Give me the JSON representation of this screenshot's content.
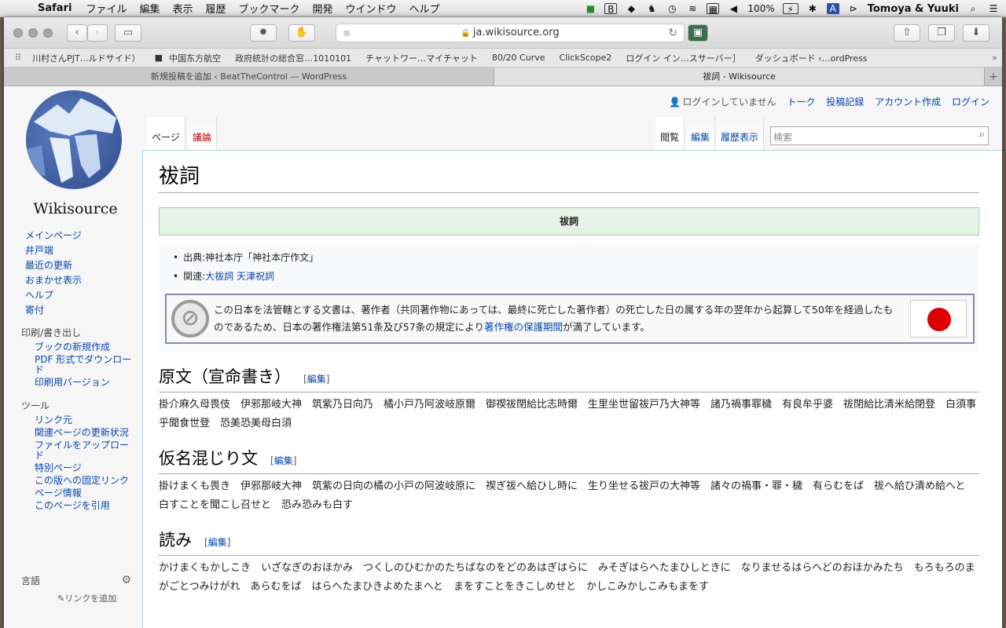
{
  "menubar": {
    "app": "Safari",
    "items": [
      "ファイル",
      "編集",
      "表示",
      "履歴",
      "ブックマーク",
      "開発",
      "ウインドウ",
      "ヘルプ"
    ],
    "battery": "100%",
    "user": "Tomoya & Yuuki"
  },
  "browser": {
    "url": "ja.wikisource.org",
    "favorites": [
      "川村さんPJT…ルドサイド）",
      "中国东方航空",
      "政府統計の総合窓…1010101",
      "チャットワー…マイチャット",
      "80/20 Curve",
      "ClickScope2",
      "ログイン イン…スサーバー］",
      "ダッシュボード ‹…ordPress"
    ],
    "tabs": [
      "新規投稿を追加 ‹ BeatTheControl — WordPress",
      "祓詞 - Wikisource"
    ]
  },
  "logo": {
    "name": "Wikisource"
  },
  "nav": {
    "main": [
      "メインページ",
      "井戸端",
      "最近の更新",
      "おまかせ表示",
      "ヘルプ",
      "寄付"
    ],
    "print_heading": "印刷/書き出し",
    "print": [
      "ブックの新規作成",
      "PDF 形式でダウンロード",
      "印刷用バージョン"
    ],
    "tools_heading": "ツール",
    "tools": [
      "リンク元",
      "関連ページの更新状況",
      "ファイルをアップロード",
      "特別ページ",
      "この版への固定リンク",
      "ページ情報",
      "このページを引用"
    ],
    "lang_heading": "言語",
    "add_links": "リンクを追加"
  },
  "personal": {
    "not_logged_in": "ログインしていません",
    "talk": "トーク",
    "contribs": "投稿記録",
    "create_account": "アカウント作成",
    "login": "ログイン"
  },
  "tabs": {
    "page": "ページ",
    "discussion": "議論",
    "read": "閲覧",
    "edit": "編集",
    "history": "履歴表示"
  },
  "search": {
    "placeholder": "検索"
  },
  "article": {
    "title": "祓詞",
    "header_title": "祓詞",
    "source_label": "出典:神社本庁「神社本庁作文」",
    "related_label": "関連:",
    "related_links": [
      "大祓詞",
      "天津祝詞"
    ],
    "license_text": "この日本を法管轄とする文書は、著作者（共同著作物にあっては、最終に死亡した著作者）の死亡した日の属する年の翌年から起算して50年を経過したものであるため、日本の著作権法第51条及び57条の規定により",
    "license_link": "著作権の保護期間",
    "license_end": "が満了しています。",
    "edit_label": "編集",
    "sections": [
      {
        "heading": "原文（宣命書き）",
        "text": "掛介麻久母畏伎　伊邪那岐大神　筑紫乃日向乃　橘小戸乃阿波岐原爾　御禊祓閉給比志時爾　生里坐世留祓戸乃大神等　諸乃禍事罪穢　有良牟乎婆　祓閉給比清米給閉登　白須事乎聞食世登　恐美恐美母白須"
      },
      {
        "heading": "仮名混じり文",
        "text": "掛けまくも畏き　伊邪那岐大神　筑紫の日向の橘の小戸の阿波岐原に　禊ぎ祓へ給ひし時に　生り坐せる祓戸の大神等　諸々の禍事・罪・穢　有らむをば　祓へ給ひ清め給へと　白すことを聞こし召せと　恐み恐みも白す"
      },
      {
        "heading": "読み",
        "text": "かけまくもかしこき　いざなぎのおほかみ　つくしのひむかのたちばなのをどのあはぎはらに　みそぎはらへたまひしときに　なりませるはらへどのおほかみたち　もろもろのまがごとつみけがれ　あらむをば　はらへたまひきよめたまへと　まをすことをきこしめせと　かしこみかしこみもまをす"
      }
    ]
  },
  "colors": {
    "link": "#0645ad",
    "red_link": "#ba0000",
    "header_green": "#e6f2e6"
  }
}
